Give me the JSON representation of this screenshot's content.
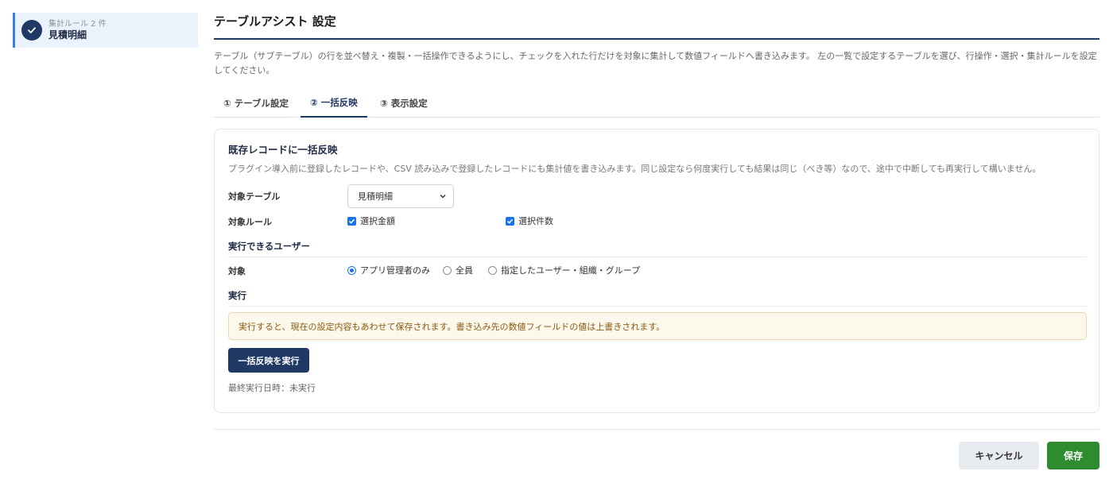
{
  "sidebar": {
    "items": [
      {
        "sub_label": "集計ルール 2 件",
        "label": "見積明細",
        "icon": "check-icon"
      }
    ]
  },
  "header": {
    "title": "テーブルアシスト 設定",
    "description": "テーブル（サブテーブル）の行を並べ替え・複製・一括操作できるようにし、チェックを入れた行だけを対象に集計して数値フィールドへ書き込みます。 左の一覧で設定するテーブルを選び、行操作・選択・集計ルールを設定してください。"
  },
  "tabs": [
    {
      "label": "① テーブル設定",
      "active": false
    },
    {
      "label": "② 一括反映",
      "active": true
    },
    {
      "label": "③ 表示設定",
      "active": false
    }
  ],
  "bulk": {
    "title": "既存レコードに一括反映",
    "description": "プラグイン導入前に登録したレコードや、CSV 読み込みで登録したレコードにも集計値を書き込みます。同じ設定なら何度実行しても結果は同じ（べき等）なので、途中で中断しても再実行して構いません。",
    "target_table_label": "対象テーブル",
    "target_table_value": "見積明細",
    "target_rules_label": "対象ルール",
    "rules": [
      {
        "label": "選択金額",
        "checked": true
      },
      {
        "label": "選択件数",
        "checked": true
      }
    ],
    "users_section": "実行できるユーザー",
    "target_label": "対象",
    "user_options": [
      {
        "label": "アプリ管理者のみ",
        "checked": true
      },
      {
        "label": "全員",
        "checked": false
      },
      {
        "label": "指定したユーザー・組織・グループ",
        "checked": false
      }
    ],
    "run_section": "実行",
    "warning": "実行すると、現在の設定内容もあわせて保存されます。書き込み先の数値フィールドの値は上書きされます。",
    "run_button": "一括反映を実行",
    "last_run": "最終実行日時：未実行"
  },
  "footer": {
    "cancel_label": "キャンセル",
    "save_label": "保存"
  },
  "colors": {
    "primary": "#1f3864",
    "accent": "#1a73e8",
    "save": "#2e8b2e",
    "warning_bg": "#fdf8ec"
  }
}
